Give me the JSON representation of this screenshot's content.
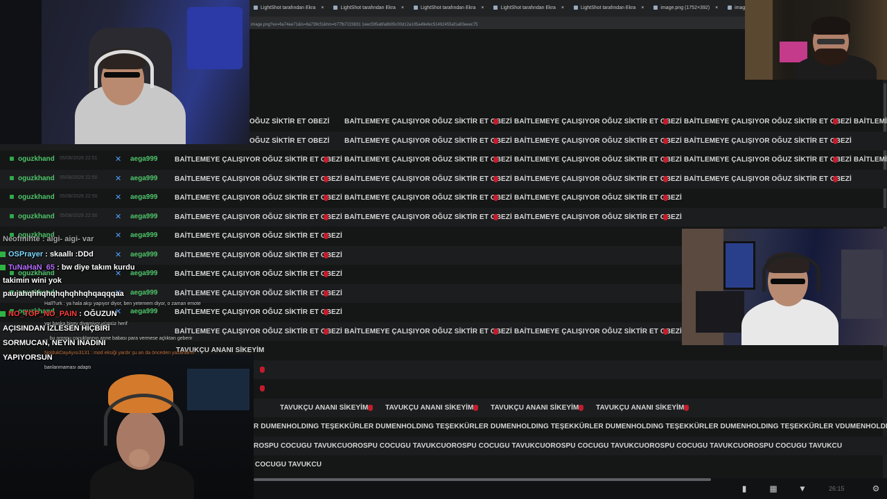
{
  "browser": {
    "tabs": [
      {
        "label": "LightShot tarafından Ekra"
      },
      {
        "label": "LightShot tarafından Ekra"
      },
      {
        "label": "LightShot tarafından Ekra"
      },
      {
        "label": "LightShot tarafından Ekra"
      },
      {
        "label": "LightShot tarafından Ekra"
      },
      {
        "label": "image.png (1752×392)"
      },
      {
        "label": "image.png (371×122)"
      }
    ],
    "url": "image.png?ex=6a74ee71&is=6a739cf1&hm=b77fb7223831 1eec595a6fa8b05c00d12a105a49efec51492455af1a83eeec75"
  },
  "messages": {
    "msg1": "BAİTLEMEYE ÇALIŞIYOR OĞUZ SİKTİR ET OBEZİ",
    "msg1_prefix": "OĞUZ SİKTİR ET OBEZİ",
    "msg1_tail": "BAİTLEMİ",
    "tavukcu": "TAVUKÇU ANANI SİKEYİM",
    "dumen": "R DUMENHOLDING TEŞEKKÜRLER DUMENHOLDING TEŞEKKÜRLER DUMENHOLDING TEŞEKKÜRLER DUMENHOLDING TEŞEKKÜRLER DUMENHOLDING TEŞEKKÜRLER VDUMENHOLDING TEŞEKKÜRLER DU",
    "orospu": "ROSPU COCUGU TAVUKCUOROSPU COCUGU TAVUKCUOROSPU COCUGU TAVUKCUOROSPU COCUGU TAVUKCUOROSPU COCUGU TAVUKCUOROSPU COCUGU TAVUKCU",
    "cocugu": "COCUGU TAVUKCU"
  },
  "rows": [
    {
      "user": "oguzkhand",
      "time": "05/08/2026 22:51",
      "sender": "aega999"
    },
    {
      "user": "oguzkhand",
      "time": "05/08/2026 22:50",
      "sender": "aega999"
    },
    {
      "user": "oguzkhand",
      "time": "05/08/2026 22:50",
      "sender": "aega999"
    },
    {
      "user": "oguzkhand",
      "time": "05/08/2026 22:50",
      "sender": "aega999"
    },
    {
      "user": "oguzkhand",
      "time": "",
      "sender": "aega999"
    },
    {
      "user": "",
      "time": "",
      "sender": "aega999"
    },
    {
      "user": "oguzkhand",
      "time": "",
      "sender": "aega999"
    },
    {
      "user": "oguzkhand",
      "time": "",
      "sender": "aega999"
    },
    {
      "user": "oguzkhand",
      "time": "",
      "sender": "aega999"
    }
  ],
  "overlay_chat": {
    "line0": "Neofmihte : aigi- aigi- var",
    "line1_name": "OSPrayer",
    "line1_text": ": skaallı :DDd",
    "line2_name": "TuNaHaN_65",
    "line2_text": ": bw diye takım kurdu",
    "line2_cont": "takimin wini yok",
    "line3": "paujahqhhqhqhqhqhhqhqaqqqaa",
    "small1": "HallTurk : ya hala akşı yapıyor diyor, ben yetemem diyor, o zaman emote",
    "line4_name": "NO_TOP_NO_PAIN",
    "line4_text": ": OĞUZUN",
    "small2": "yor başka bişey diyemiyor yüzsüz herif",
    "line5": "AÇISINDAN İZLESEN HİÇBİRİ",
    "small3": "... bu orospu çocuklarının anne babası para vermese açlıktan geberir",
    "line6": "SORMUCAN, NEYİN İNADINI",
    "small4": "NoldukDayAyısı3131 : mod eksiği yardır şu an da önceden yazanların",
    "line7": "YAPIYORSUN",
    "small5": "banlanmaması adaptı"
  },
  "status": {
    "clock": "26:15"
  },
  "colors": {
    "username": "#4ec46a",
    "emote": "#c21c2c",
    "badge": "#2ea84a"
  }
}
